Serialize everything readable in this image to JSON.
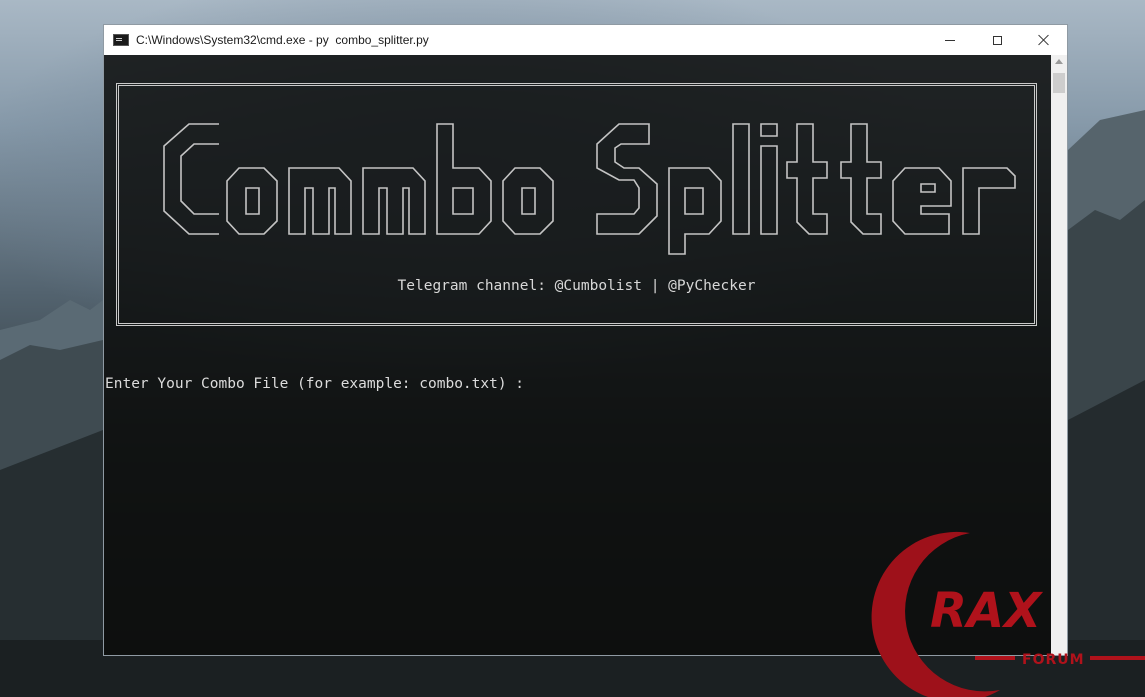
{
  "window": {
    "title": "C:\\Windows\\System32\\cmd.exe - py  combo_splitter.py",
    "app_icon": "console-icon",
    "controls": [
      "minimize-icon",
      "maximize-icon",
      "close-icon"
    ]
  },
  "console": {
    "banner_ascii_text": "Combo Splitter",
    "telegram_line": "Telegram channel: @Cumbolist | @PyChecker",
    "prompt": "Enter Your Combo File (for example: combo.txt) :"
  },
  "watermark": {
    "logo_text": "RAX",
    "sub_text": "FORUM",
    "color": "#b0121b"
  },
  "colors": {
    "console_text": "#dcdcdc",
    "titlebar": "#ffffff"
  }
}
